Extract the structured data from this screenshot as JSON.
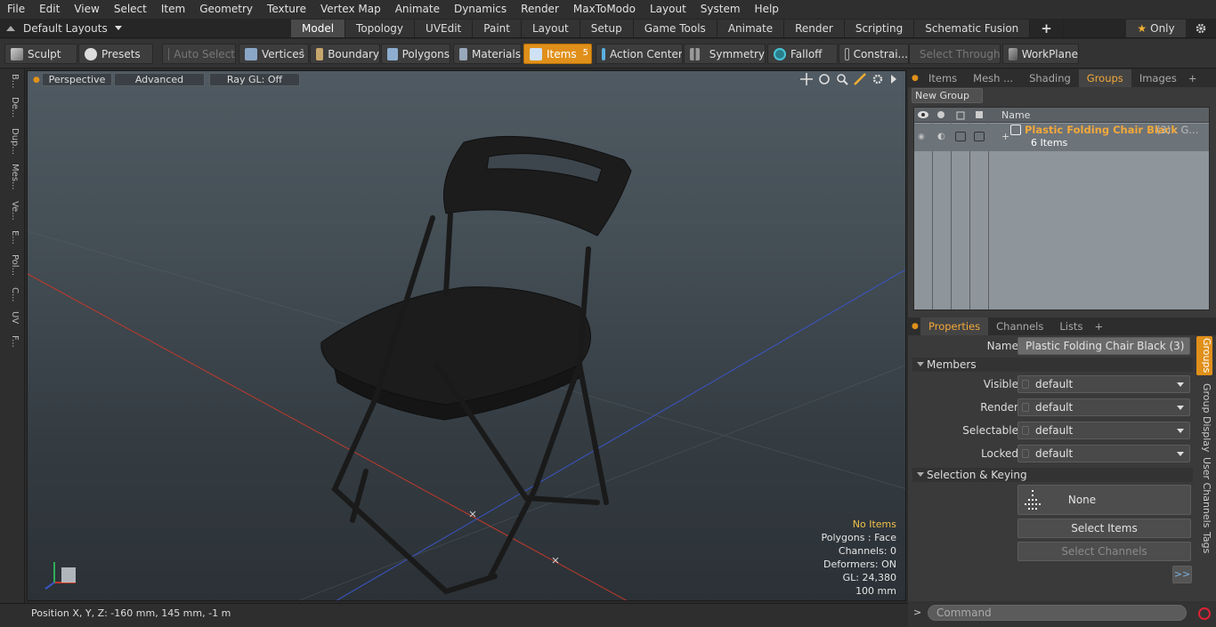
{
  "menu": [
    "File",
    "Edit",
    "View",
    "Select",
    "Item",
    "Geometry",
    "Texture",
    "Vertex Map",
    "Animate",
    "Dynamics",
    "Render",
    "MaxToModo",
    "Layout",
    "System",
    "Help"
  ],
  "layouts_label": "Default Layouts",
  "main_tabs": [
    "Model",
    "Topology",
    "UVEdit",
    "Paint",
    "Layout",
    "Setup",
    "Game Tools",
    "Animate",
    "Render",
    "Scripting",
    "Schematic Fusion"
  ],
  "add_tab": "+",
  "only_label": "Only",
  "toolbar": {
    "sculpt": "Sculpt",
    "presets": "Presets",
    "auto_select": "Auto Select",
    "vertices": "Vertices",
    "vertices_count": "1",
    "boundary": "Boundary",
    "polygons": "Polygons",
    "materials": "Materials",
    "items": "Items",
    "items_count": "5",
    "action_center": "Action Center",
    "symmetry": "Symmetry",
    "falloff": "Falloff",
    "constraints": "Constrai...",
    "select_through": "Select Through",
    "workplane": "WorkPlane"
  },
  "left_tabs": [
    "B...",
    "De...",
    "Dup...",
    "Mes...",
    "Ve...",
    "E...",
    "Pol...",
    "C...",
    "UV",
    "F..."
  ],
  "viewport": {
    "tabs": [
      "Perspective",
      "Advanced",
      "Ray GL: Off"
    ],
    "info": {
      "no_items": "No Items",
      "polygons": "Polygons : Face",
      "channels": "Channels: 0",
      "deformers": "Deformers: ON",
      "gl": "GL: 24,380",
      "scale": "100 mm"
    }
  },
  "status": {
    "position": "Position X, Y, Z:  -160 mm, 145 mm, -1 m"
  },
  "right_top": {
    "tabs": [
      "Items",
      "Mesh ...",
      "Shading",
      "Groups",
      "Images"
    ],
    "active_tab": "Groups",
    "new_group": "New Group",
    "col_name": "Name",
    "group_name": "Plastic Folding Chair Black",
    "group_suffix": "(3) : G...",
    "group_items": "6 Items"
  },
  "properties": {
    "tabs": [
      "Properties",
      "Channels",
      "Lists"
    ],
    "name_label": "Name",
    "name_value": "Plastic Folding Chair Black (3)",
    "members_section": "Members",
    "rows": [
      {
        "label": "Visible",
        "value": "default"
      },
      {
        "label": "Render",
        "value": "default"
      },
      {
        "label": "Selectable",
        "value": "default"
      },
      {
        "label": "Locked",
        "value": "default"
      }
    ],
    "selection_section": "Selection & Keying",
    "none_label": "None",
    "select_items": "Select Items",
    "select_channels": "Select Channels",
    "more": ">>"
  },
  "side_tabs": [
    "Groups",
    "Group Display",
    "User Channels",
    "Tags"
  ],
  "command_placeholder": "Command",
  "colors": {
    "accent": "#e0901a",
    "group_text": "#f3a83a"
  }
}
